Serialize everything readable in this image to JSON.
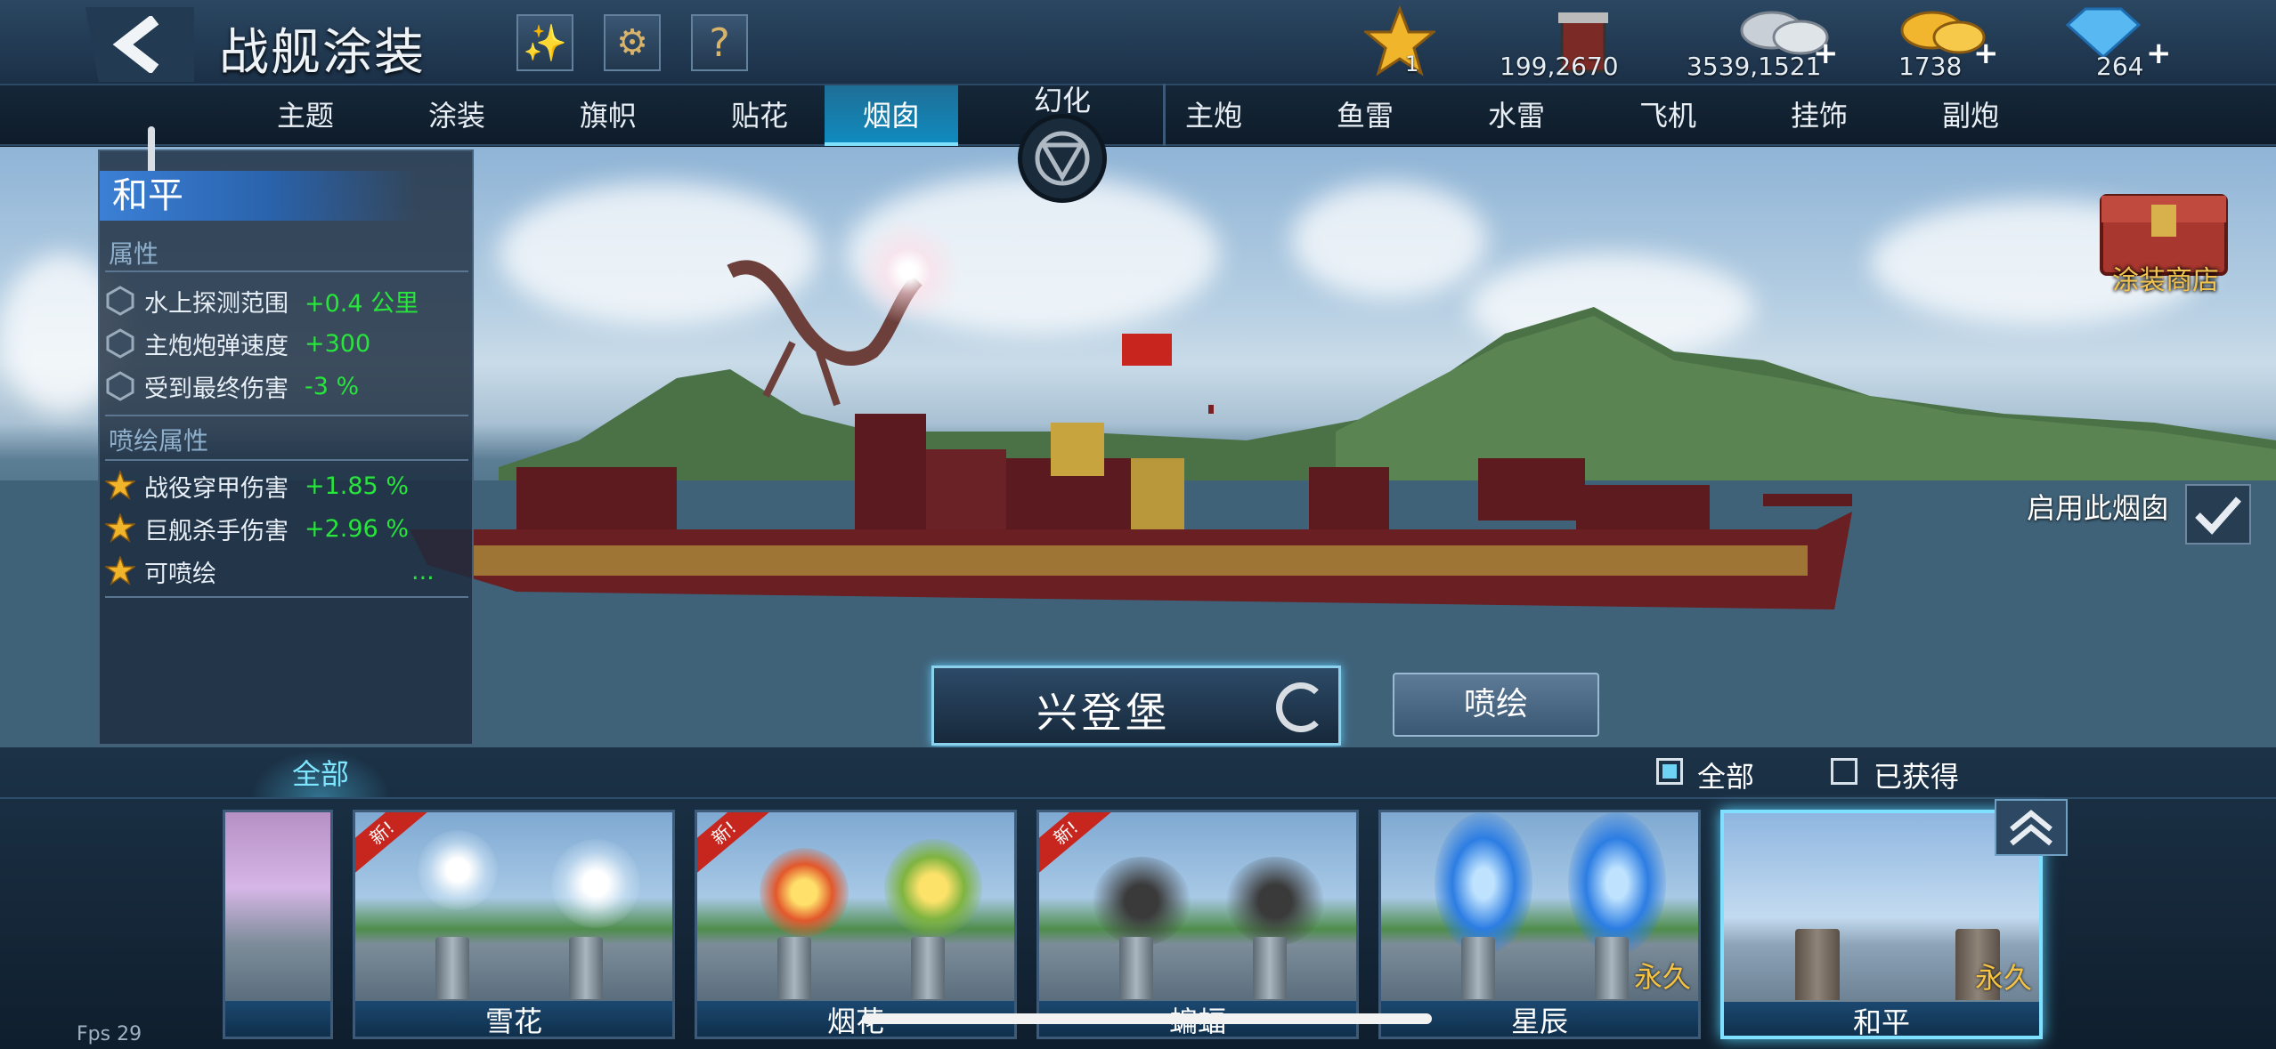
{
  "header": {
    "title": "战舰涂装",
    "buttons": [
      "fireworks-icon",
      "gear-icon",
      "help-icon"
    ],
    "help_label": "?"
  },
  "resources": {
    "stars": "1",
    "paint": "199,2670",
    "silver": "3539,1521",
    "gold": "1738",
    "diamond": "264"
  },
  "tabs": [
    "主题",
    "涂装",
    "旗帜",
    "贴花",
    "烟囱",
    "主炮",
    "鱼雷",
    "水雷",
    "飞机",
    "挂饰",
    "副炮"
  ],
  "active_tab": "烟囱",
  "huanhua_label": "幻化",
  "panel": {
    "title": "和平",
    "section1": "属性",
    "attrs": [
      {
        "label": "水上探测范围",
        "value": "+0.4 公里"
      },
      {
        "label": "主炮炮弹速度",
        "value": "+300"
      },
      {
        "label": "受到最终伤害",
        "value": "-3 %"
      }
    ],
    "section2": "喷绘属性",
    "spray": [
      {
        "label": "战役穿甲伤害",
        "value": "+1.85 %"
      },
      {
        "label": "巨舰杀手伤害",
        "value": "+2.96 %"
      },
      {
        "label": "可喷绘",
        "value": "..."
      }
    ]
  },
  "ship_name": "兴登堡",
  "paint_button": "喷绘",
  "enable_label": "启用此烟囱",
  "shop_label": "涂装商店",
  "filter": {
    "tab_all": "全部",
    "check_all": "全部",
    "check_owned": "已获得"
  },
  "cards": [
    {
      "name": "",
      "perm": "",
      "new": ""
    },
    {
      "name": "雪花",
      "perm": "",
      "new": "新!"
    },
    {
      "name": "烟花",
      "perm": "",
      "new": "新!"
    },
    {
      "name": "蝙蝠",
      "perm": "",
      "new": "新!"
    },
    {
      "name": "星辰",
      "perm": "永久",
      "new": ""
    },
    {
      "name": "和平",
      "perm": "永久",
      "new": ""
    }
  ],
  "fps": "Fps 29",
  "colors": {
    "accent": "#7fe0ff",
    "positive": "#27e53a",
    "gold": "#f3c243",
    "active_tab": "#0f8cc0"
  }
}
